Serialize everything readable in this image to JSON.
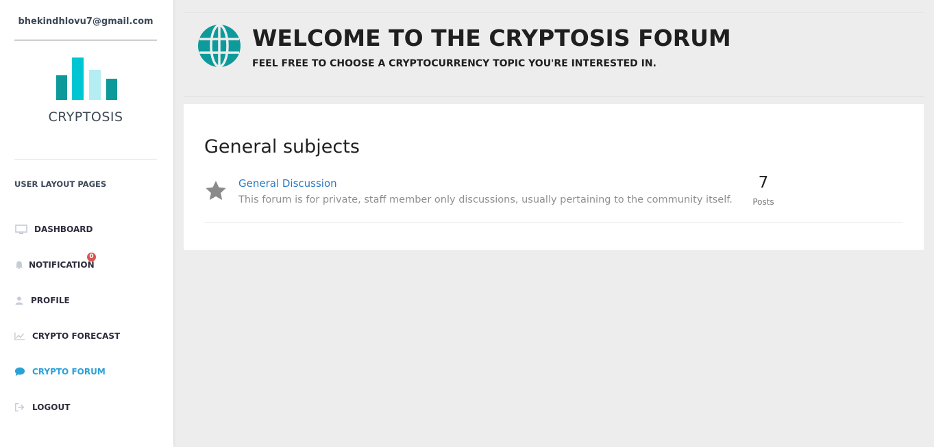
{
  "sidebar": {
    "user_email": "bhekindhlovu7@gmail.com",
    "logo_text": "CRYPTOSIS",
    "section_title": "USER LAYOUT PAGES",
    "notification_badge": "0",
    "items": [
      {
        "label": "DASHBOARD",
        "icon": "monitor-icon"
      },
      {
        "label": "NOTIFICATION",
        "icon": "bell-icon"
      },
      {
        "label": "PROFILE",
        "icon": "user-icon"
      },
      {
        "label": "CRYPTO FORECAST",
        "icon": "line-chart-icon"
      },
      {
        "label": "CRYPTO FORUM",
        "icon": "chat-bubble-icon",
        "active": true
      },
      {
        "label": "LOGOUT",
        "icon": "sign-out-icon"
      }
    ]
  },
  "header": {
    "title": "WELCOME TO THE CRYPTOSIS FORUM",
    "subtitle": "FEEL FREE TO CHOOSE A CRYPTOCURRENCY TOPIC YOU'RE INTERESTED IN.",
    "icon": "globe-icon"
  },
  "main": {
    "section_title": "General subjects",
    "forums": [
      {
        "title": "General Discussion",
        "description": "This forum is for private, staff member only discussions, usually pertaining to the community itself.",
        "post_count": "7",
        "post_label": "Posts",
        "icon": "star-icon"
      }
    ]
  },
  "colors": {
    "accent": "#2aa2d8",
    "link": "#2a7ac6",
    "teal_dark": "#0e9a9a",
    "teal_light": "#00c6d3",
    "badge": "#d9534f",
    "background": "#ededed"
  }
}
